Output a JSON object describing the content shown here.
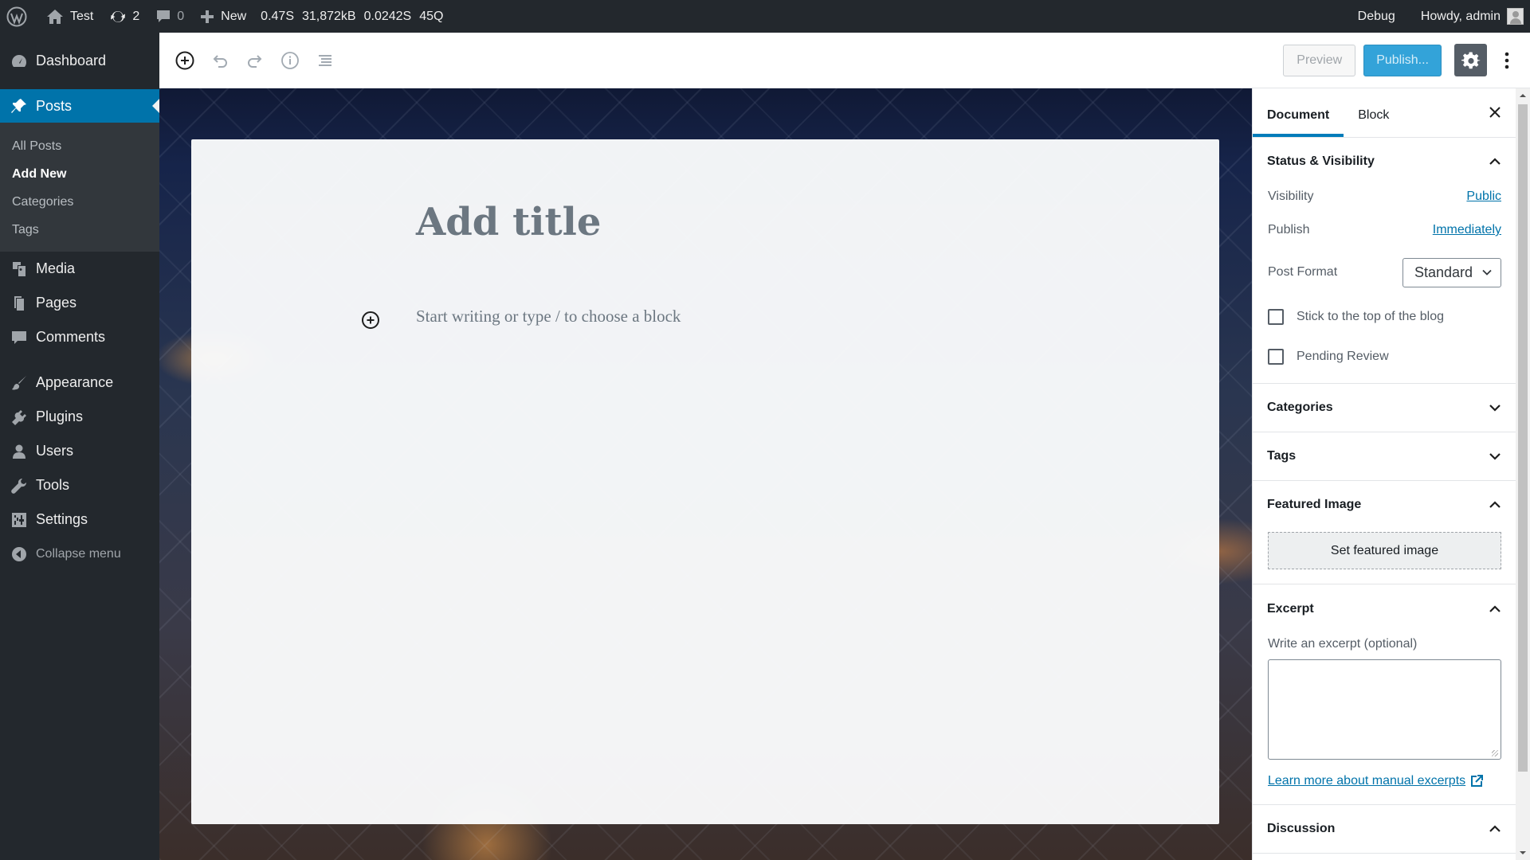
{
  "adminbar": {
    "site_name": "Test",
    "updates_count": "2",
    "comments_count": "0",
    "new_label": "New",
    "debug_time": "0.47S",
    "debug_memory": "31,872kB",
    "debug_query_time": "0.0242S",
    "debug_queries": "45Q",
    "debug_label": "Debug",
    "howdy": "Howdy, admin"
  },
  "sidebar": {
    "items": [
      {
        "label": "Dashboard",
        "icon": "dashboard-icon"
      },
      {
        "label": "Posts",
        "icon": "pin-icon"
      },
      {
        "label": "Media",
        "icon": "media-icon"
      },
      {
        "label": "Pages",
        "icon": "pages-icon"
      },
      {
        "label": "Comments",
        "icon": "comments-icon"
      },
      {
        "label": "Appearance",
        "icon": "brush-icon"
      },
      {
        "label": "Plugins",
        "icon": "plug-icon"
      },
      {
        "label": "Users",
        "icon": "user-icon"
      },
      {
        "label": "Tools",
        "icon": "wrench-icon"
      },
      {
        "label": "Settings",
        "icon": "settings-icon"
      }
    ],
    "posts_submenu": [
      "All Posts",
      "Add New",
      "Categories",
      "Tags"
    ],
    "collapse": "Collapse menu"
  },
  "header": {
    "preview": "Preview",
    "publish": "Publish..."
  },
  "editor": {
    "title_placeholder": "Add title",
    "block_placeholder": "Start writing or type / to choose a block"
  },
  "settings": {
    "tabs": [
      "Document",
      "Block"
    ],
    "status_visibility": {
      "heading": "Status & Visibility",
      "visibility_label": "Visibility",
      "visibility_value": "Public",
      "publish_label": "Publish",
      "publish_value": "Immediately",
      "post_format_label": "Post Format",
      "post_format_value": "Standard",
      "stick_label": "Stick to the top of the blog",
      "pending_label": "Pending Review"
    },
    "categories": "Categories",
    "tags": "Tags",
    "featured_image": {
      "heading": "Featured Image",
      "button": "Set featured image"
    },
    "excerpt": {
      "heading": "Excerpt",
      "label": "Write an excerpt (optional)",
      "value": "",
      "learn_more": "Learn more about manual excerpts"
    },
    "discussion": "Discussion"
  },
  "colors": {
    "admin_bg": "#23282d",
    "accent": "#0073aa",
    "publish": "#33a3d9"
  }
}
